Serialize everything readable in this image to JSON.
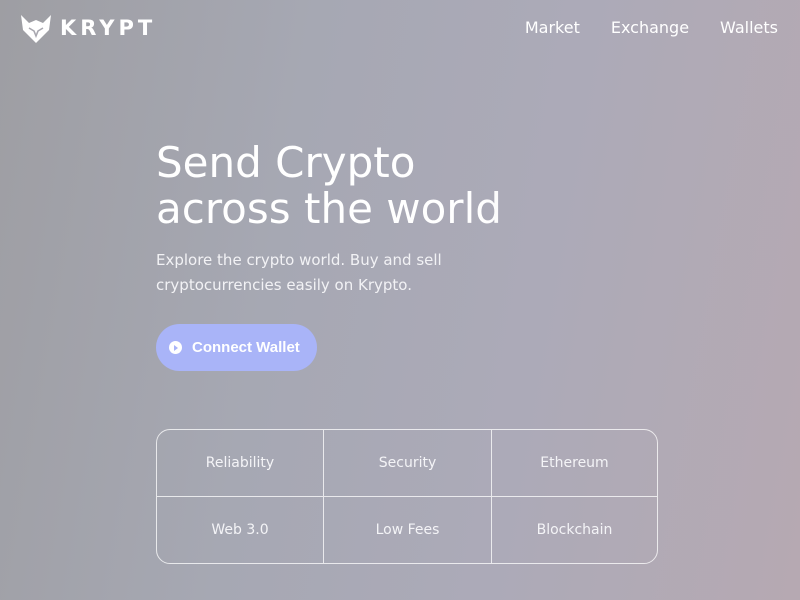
{
  "brand": {
    "name": "KRYPT",
    "logo_icon": "fox-logo-icon"
  },
  "nav": {
    "items": [
      "Market",
      "Exchange",
      "Wallets"
    ]
  },
  "hero": {
    "title_line1": "Send Crypto",
    "title_line2": "across the world",
    "subtitle_line1": "Explore the crypto world. Buy and sell",
    "subtitle_line2": "cryptocurrencies easily on Krypto."
  },
  "cta": {
    "label": "Connect Wallet",
    "icon": "play-circle-icon",
    "color": "#a9b4f8"
  },
  "features": {
    "items": [
      "Reliability",
      "Security",
      "Ethereum",
      "Web 3.0",
      "Low Fees",
      "Blockchain"
    ]
  }
}
